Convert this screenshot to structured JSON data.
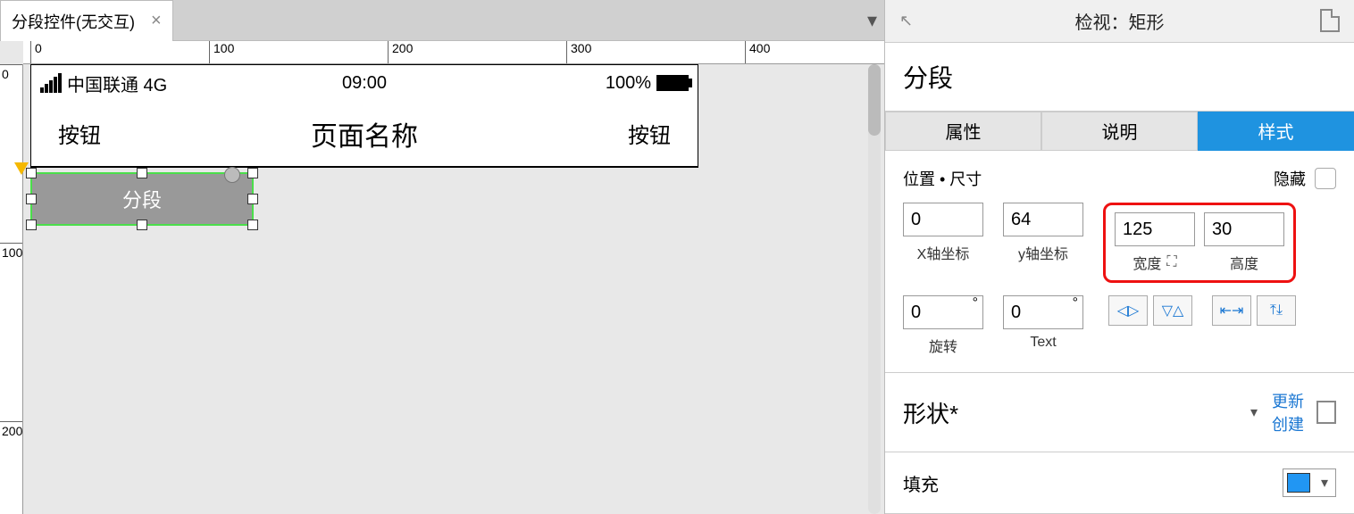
{
  "tab": {
    "title": "分段控件(无交互)"
  },
  "ruler": {
    "h_majors": [
      0,
      100,
      200,
      300,
      400
    ],
    "v_majors": [
      0,
      100,
      200
    ]
  },
  "phone": {
    "carrier": "中国联通 4G",
    "time": "09:00",
    "battery_pct": "100%",
    "nav_left": "按钮",
    "nav_title": "页面名称",
    "nav_right": "按钮"
  },
  "segment": {
    "label": "分段"
  },
  "inspector": {
    "header": "检视：矩形",
    "widget_name": "分段",
    "tabs": {
      "prop": "属性",
      "note": "说明",
      "style": "样式"
    },
    "pos_section": {
      "title": "位置 • 尺寸",
      "hide": "隐藏",
      "x": "0",
      "x_label": "X轴坐标",
      "y": "64",
      "y_label": "y轴坐标",
      "w": "125",
      "w_label": "宽度",
      "h": "30",
      "h_label": "高度",
      "rot": "0",
      "rot_label": "旋转",
      "text_rot": "0",
      "text_label": "Text"
    },
    "shape": {
      "title": "形状*",
      "link_update": "更新",
      "link_create": "创建"
    },
    "fill": {
      "title": "填充",
      "color": "#2196f3"
    }
  }
}
